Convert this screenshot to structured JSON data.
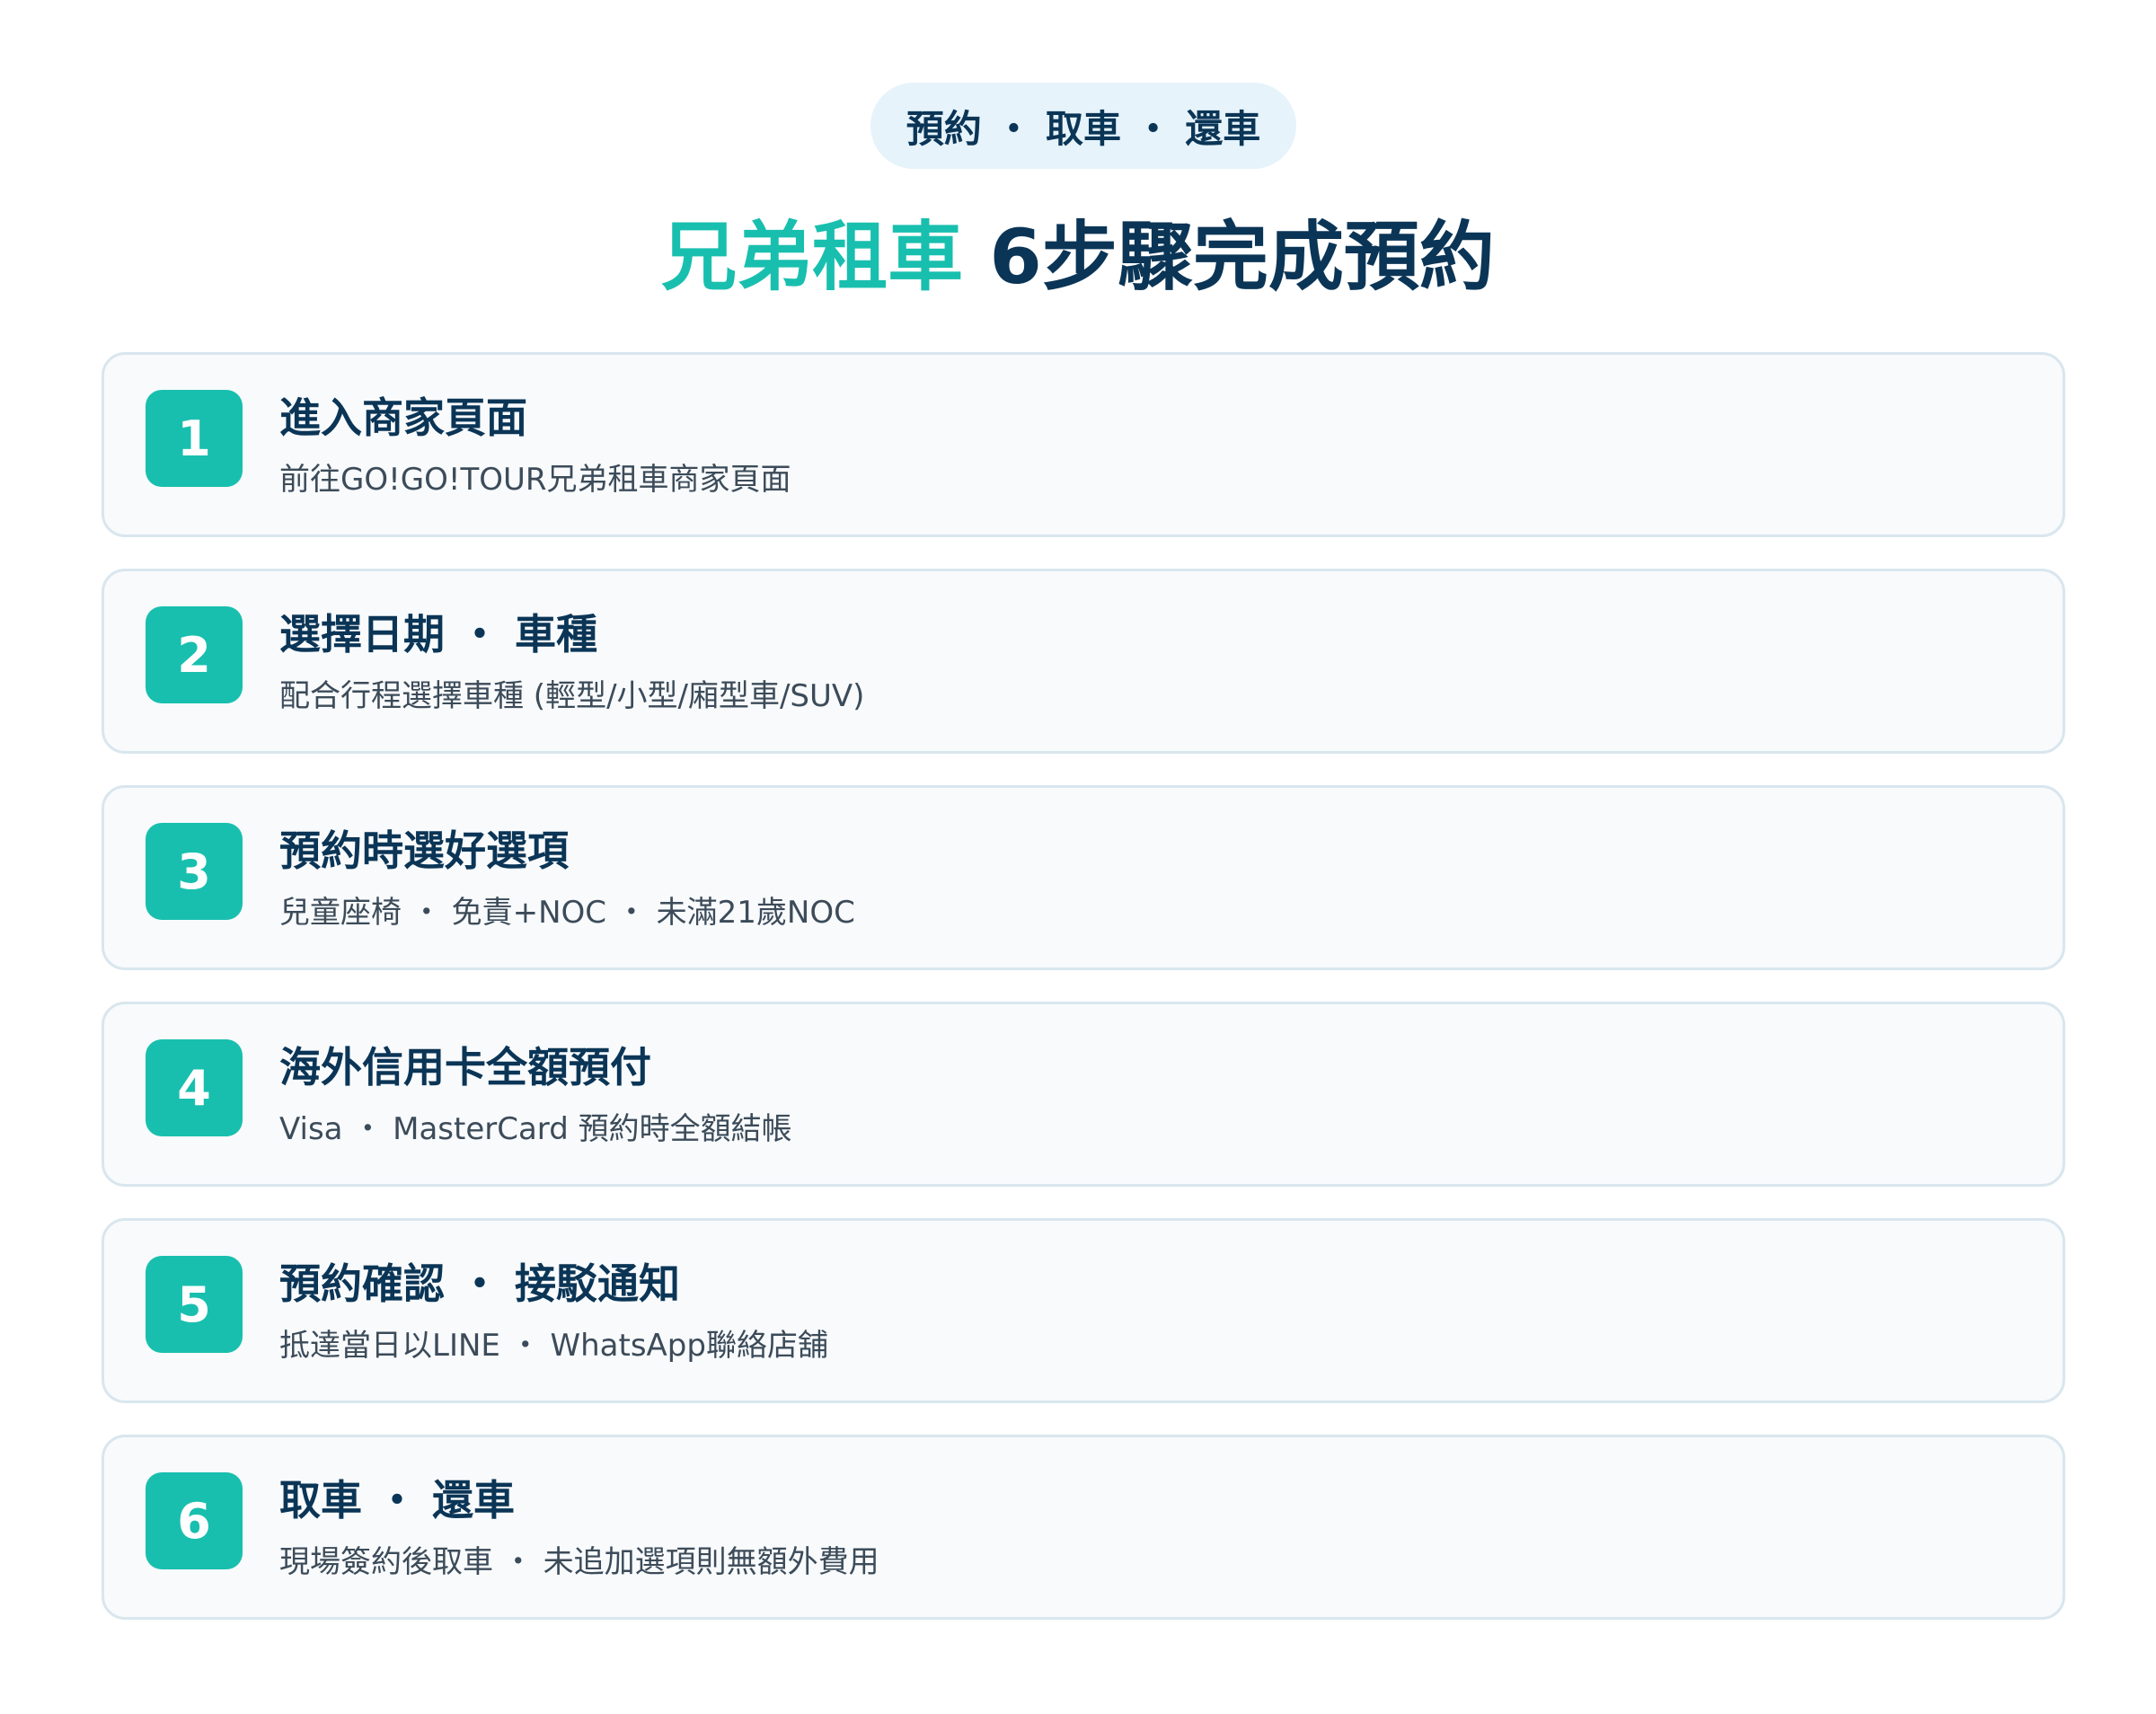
{
  "header": {
    "pill_label": "預約 ・ 取車 ・ 還車",
    "title_brand": "兄弟租車",
    "title_rest": " 6步驟完成預約"
  },
  "steps": [
    {
      "number": "1",
      "title": "進入商家頁面",
      "desc": "前往GO!GO!TOUR兄弟租車商家頁面"
    },
    {
      "number": "2",
      "title": "選擇日期 ・ 車種",
      "desc": "配合行程選擇車種 (輕型/小型/廂型車/SUV)"
    },
    {
      "number": "3",
      "title": "預約時選好選項",
      "desc": "兒童座椅 ・ 免責+NOC ・ 未滿21歲NOC"
    },
    {
      "number": "4",
      "title": "海外信用卡全額預付",
      "desc": "Visa ・ MasterCard 預約時全額結帳"
    },
    {
      "number": "5",
      "title": "預約確認 ・ 接駁通知",
      "desc": "抵達當日以LINE ・ WhatsApp聯絡店舖"
    },
    {
      "number": "6",
      "title": "取車 ・ 還車",
      "desc": "現場簽約後取車 ・ 未追加選項則無額外費用"
    }
  ],
  "colors": {
    "accent": "#19bfae",
    "heading": "#0b3556",
    "pill_bg": "#e6f3fb",
    "card_bg": "#f8fafc",
    "card_border": "#d9e6ee"
  }
}
